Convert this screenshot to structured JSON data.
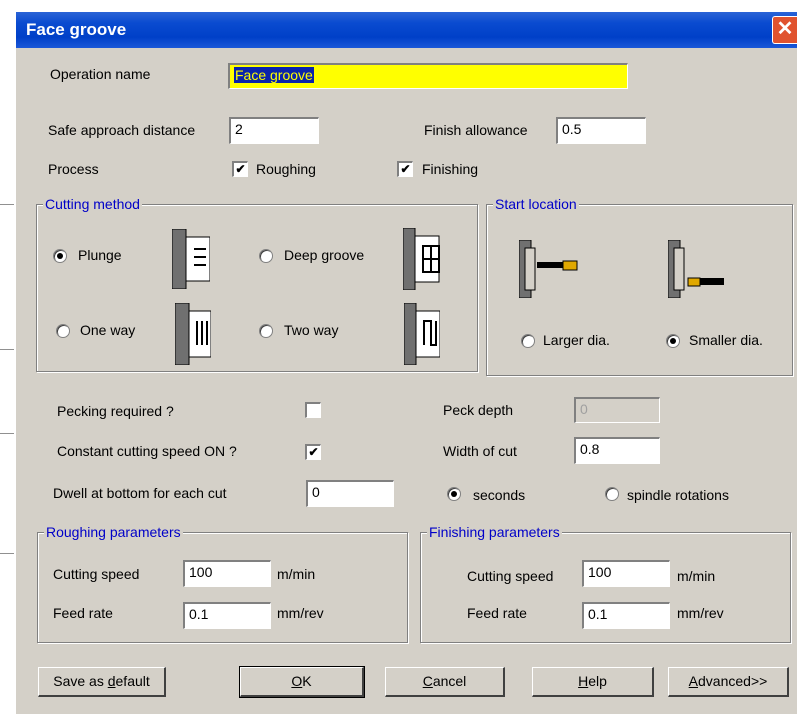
{
  "window": {
    "title": "Face groove",
    "close_glyph": "✕"
  },
  "operation": {
    "label": "Operation name",
    "value": "Face groove"
  },
  "safe_approach": {
    "label": "Safe approach distance",
    "value": "2"
  },
  "finish_allowance": {
    "label": "Finish allowance",
    "value": "0.5"
  },
  "process": {
    "label": "Process",
    "roughing": "Roughing",
    "finishing": "Finishing",
    "roughing_checked": true,
    "finishing_checked": true
  },
  "cutting_method": {
    "title": "Cutting method",
    "plunge": "Plunge",
    "deep_groove": "Deep groove",
    "one_way": "One way",
    "two_way": "Two way",
    "selected": "Plunge"
  },
  "start_location": {
    "title": "Start location",
    "larger": "Larger dia.",
    "smaller": "Smaller dia.",
    "selected": "Smaller dia."
  },
  "pecking": {
    "label": "Pecking required ?",
    "checked": false
  },
  "peck_depth": {
    "label": "Peck depth",
    "value": "0"
  },
  "constant_speed": {
    "label": "Constant cutting speed ON ?",
    "checked": true
  },
  "width_of_cut": {
    "label": "Width of cut",
    "value": "0.8"
  },
  "dwell": {
    "label": "Dwell at bottom for each cut",
    "value": "0",
    "seconds": "seconds",
    "spindle": "spindle rotations",
    "selected": "seconds"
  },
  "roughing_params": {
    "title": "Roughing parameters",
    "speed_label": "Cutting speed",
    "speed_value": "100",
    "speed_unit": "m/min",
    "feed_label": "Feed rate",
    "feed_value": "0.1",
    "feed_unit": "mm/rev"
  },
  "finishing_params": {
    "title": "Finishing parameters",
    "speed_label": "Cutting speed",
    "speed_value": "100",
    "speed_unit": "m/min",
    "feed_label": "Feed rate",
    "feed_value": "0.1",
    "feed_unit": "mm/rev"
  },
  "buttons": {
    "save_default": {
      "pre": "Save as ",
      "key": "d",
      "post": "efault"
    },
    "ok": {
      "pre": "",
      "key": "O",
      "post": "K"
    },
    "cancel": {
      "pre": "",
      "key": "C",
      "post": "ancel"
    },
    "help": {
      "pre": "",
      "key": "H",
      "post": "elp"
    },
    "advanced": {
      "pre": "",
      "key": "A",
      "post": "dvanced>>"
    }
  },
  "colors": {
    "titlebar": "#0a4bd0",
    "group_title": "#0000c8",
    "highlight_field": "#ffff00"
  }
}
